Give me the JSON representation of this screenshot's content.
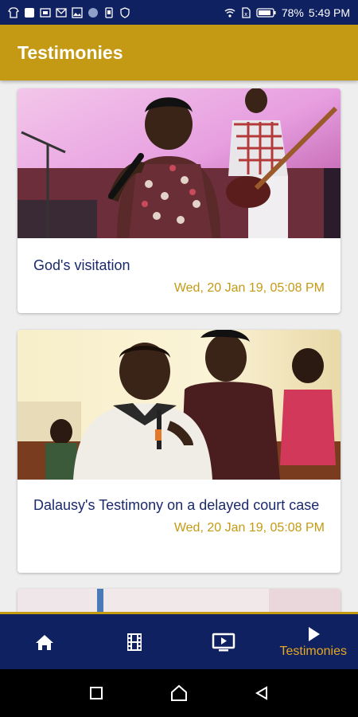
{
  "status_bar": {
    "battery": "78%",
    "time": "5:49 PM"
  },
  "app_bar": {
    "title": "Testimonies"
  },
  "cards": [
    {
      "title": "God's visitation",
      "date": "Wed, 20 Jan 19, 05:08 PM",
      "image": "woman-singing-with-microphone-photo"
    },
    {
      "title": "Dalausy's Testimony on a delayed court case",
      "date": "Wed, 20 Jan 19, 05:08 PM",
      "image": "man-testifying-with-microphone-photo"
    }
  ],
  "bottom_nav": {
    "items": [
      {
        "icon": "home-icon",
        "label": ""
      },
      {
        "icon": "film-icon",
        "label": ""
      },
      {
        "icon": "tv-play-icon",
        "label": ""
      },
      {
        "icon": "play-icon",
        "label": "Testimonies",
        "active": true
      }
    ]
  },
  "colors": {
    "primary": "#0f2160",
    "accent": "#c49a14",
    "title_text": "#1a2a6c"
  }
}
